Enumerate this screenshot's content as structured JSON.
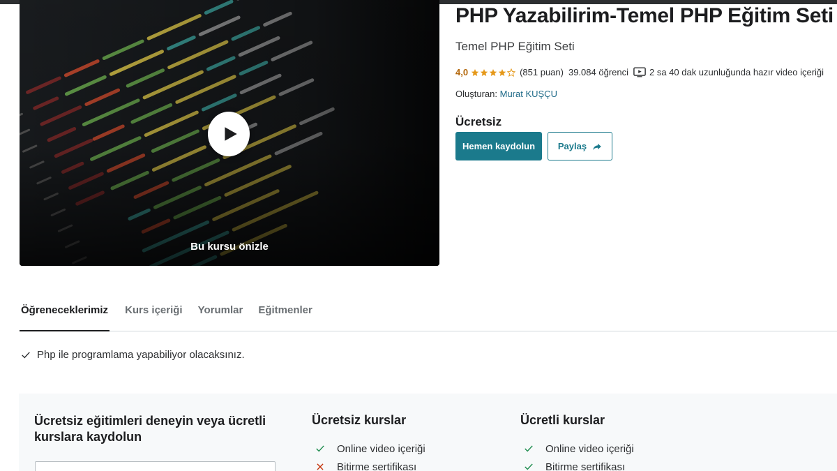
{
  "preview": {
    "label": "Bu kursu önizle"
  },
  "course": {
    "title": "PHP Yazabilirim-Temel PHP Eğitim Seti",
    "subtitle": "Temel PHP Eğitim Seti",
    "rating": "4,0",
    "rating_value": 4.0,
    "rating_count": "(851 puan)",
    "students": "39.084 öğrenci",
    "duration": "2 sa 40 dak uzunluğunda hazır video içeriği",
    "creator_label": "Oluşturan:",
    "creator_name": "Murat KUŞÇU",
    "price": "Ücretsiz",
    "enroll_label": "Hemen kaydolun",
    "share_label": "Paylaş"
  },
  "tabs": [
    {
      "label": "Öğreneceklerimiz"
    },
    {
      "label": "Kurs içeriği"
    },
    {
      "label": "Yorumlar"
    },
    {
      "label": "Eğitmenler"
    }
  ],
  "learn": {
    "item": "Php ile programlama yapabiliyor olacaksınız."
  },
  "compare": {
    "heading": "Ücretsiz eğitimleri deneyin veya ücretli kurslara kaydolun",
    "free": {
      "title": "Ücretsiz kurslar",
      "items": [
        "Online video içeriği",
        "Bitirme sertifikası"
      ]
    },
    "paid": {
      "title": "Ücretli kurslar",
      "items": [
        "Online video içeriği",
        "Bitirme sertifikası"
      ]
    }
  },
  "colors": {
    "accent": "#1b7a8c",
    "star": "#e59819",
    "rating_text": "#b4690e",
    "link": "#1e6a88",
    "check": "#1e8c4e",
    "cross": "#c4320a"
  },
  "icons": [
    "play-icon",
    "star-icon",
    "video-icon",
    "share-arrow-icon",
    "check-icon",
    "cross-icon"
  ]
}
